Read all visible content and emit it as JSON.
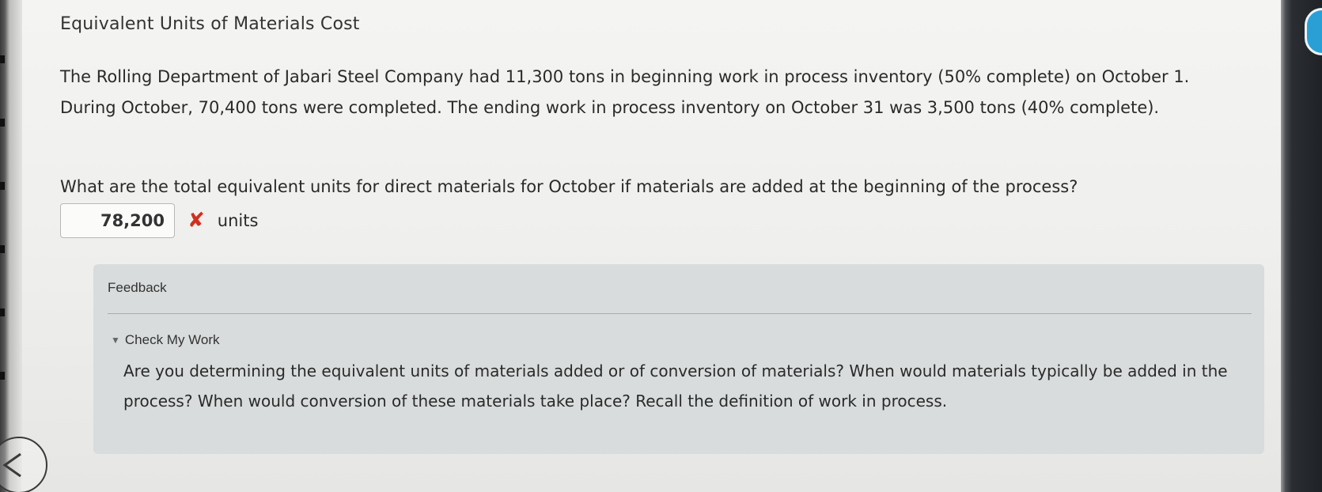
{
  "title": "Equivalent Units of Materials Cost",
  "problem": "The Rolling Department of Jabari Steel Company had 11,300 tons in beginning work in process inventory (50% complete) on October 1. During October, 70,400 tons were completed. The ending work in process inventory on October 31 was 3,500 tons (40% complete).",
  "question": "What are the total equivalent units for direct materials for October if materials are added at the beginning of the process?",
  "answer": {
    "value": "78,200",
    "status_icon": "x-icon",
    "status_color": "#d1301f",
    "unit": "units"
  },
  "feedback": {
    "label": "Feedback",
    "toggle_label": "Check My Work",
    "toggle_icon": "triangle-down-icon",
    "text": "Are you determining the equivalent units of materials added or of conversion of materials? When would materials typically be added in the process? When would conversion of these materials take place? Recall the definition of work in process."
  }
}
